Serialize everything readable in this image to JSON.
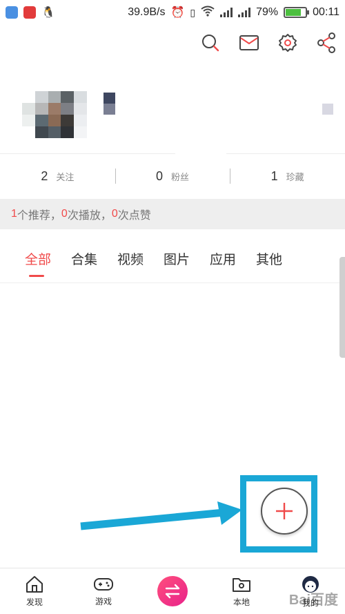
{
  "status_bar": {
    "speed": "39.9B/s",
    "battery": "79%",
    "battery_level": 0.79,
    "time": "00:11"
  },
  "stats": [
    {
      "count": "2",
      "label": "关注"
    },
    {
      "count": "0",
      "label": "粉丝"
    },
    {
      "count": "1",
      "label": "珍藏"
    }
  ],
  "summary": {
    "recommend_count": "1",
    "recommend_label": "个推荐，",
    "play_count": "0",
    "play_label": "次播放，",
    "like_count": "0",
    "like_label": "次点赞"
  },
  "tabs": [
    "全部",
    "合集",
    "视频",
    "图片",
    "应用",
    "其他"
  ],
  "active_tab": "全部",
  "bottom_nav": [
    {
      "label": "发现",
      "icon": "home-icon"
    },
    {
      "label": "游戏",
      "icon": "gamepad-icon"
    },
    {
      "label": "",
      "icon": "transfer-icon"
    },
    {
      "label": "本地",
      "icon": "folder-icon"
    },
    {
      "label": "我的",
      "icon": "avatar-icon"
    }
  ],
  "watermark": "Bai百度",
  "colors": {
    "accent": "#f04a4a",
    "annotation": "#1aa7d6",
    "center_button": "#e8228a"
  }
}
